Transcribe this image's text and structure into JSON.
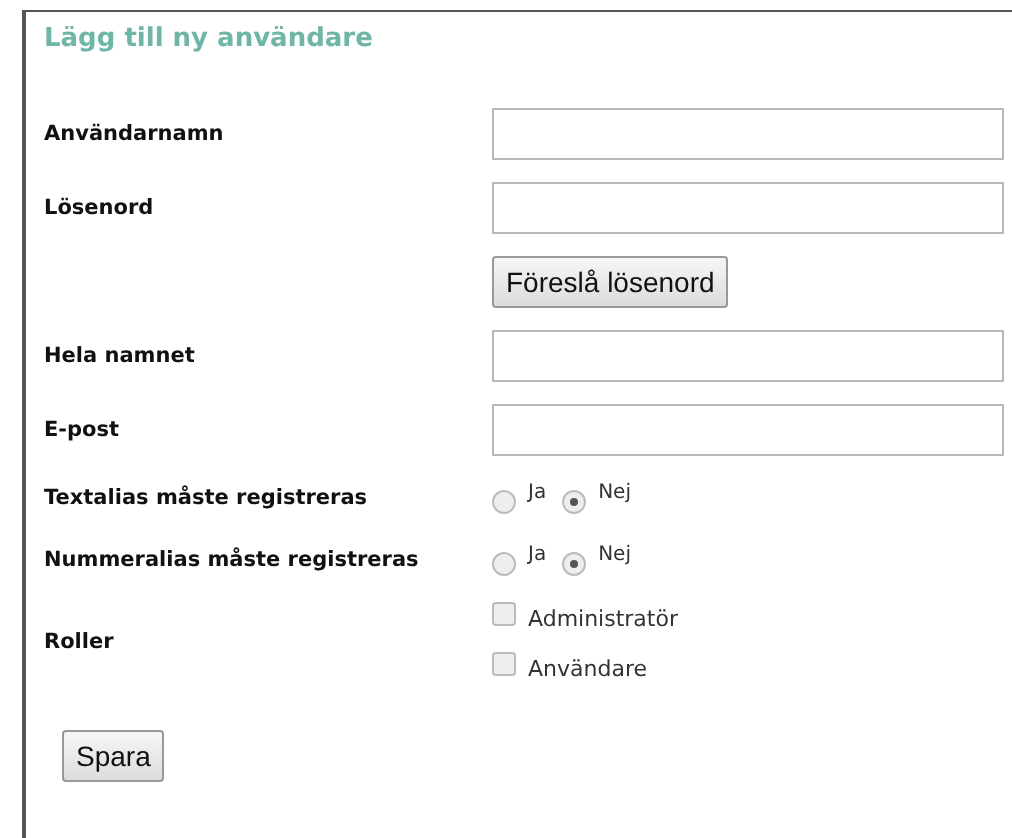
{
  "title": "Lägg till ny användare",
  "rows": [
    {
      "kind": "text",
      "label": "Användarnamn",
      "value": ""
    },
    {
      "kind": "text",
      "label": "Lösenord",
      "value": ""
    },
    {
      "kind": "button",
      "label": "",
      "button": "Föreslå lösenord"
    },
    {
      "kind": "text",
      "label": "Hela namnet",
      "value": ""
    },
    {
      "kind": "text",
      "label": "E-post",
      "value": ""
    },
    {
      "kind": "radio",
      "label": "Textalias måste registreras",
      "options": [
        {
          "label": "Ja",
          "selected": false
        },
        {
          "label": "Nej",
          "selected": true
        }
      ]
    },
    {
      "kind": "radio",
      "label": "Nummeralias måste registreras",
      "options": [
        {
          "label": "Ja",
          "selected": false
        },
        {
          "label": "Nej",
          "selected": true
        }
      ]
    },
    {
      "kind": "checkbox",
      "label": "Roller",
      "options": [
        {
          "label": "Administratör",
          "checked": false
        },
        {
          "label": "Användare",
          "checked": false
        }
      ]
    }
  ],
  "submit": "Spara"
}
